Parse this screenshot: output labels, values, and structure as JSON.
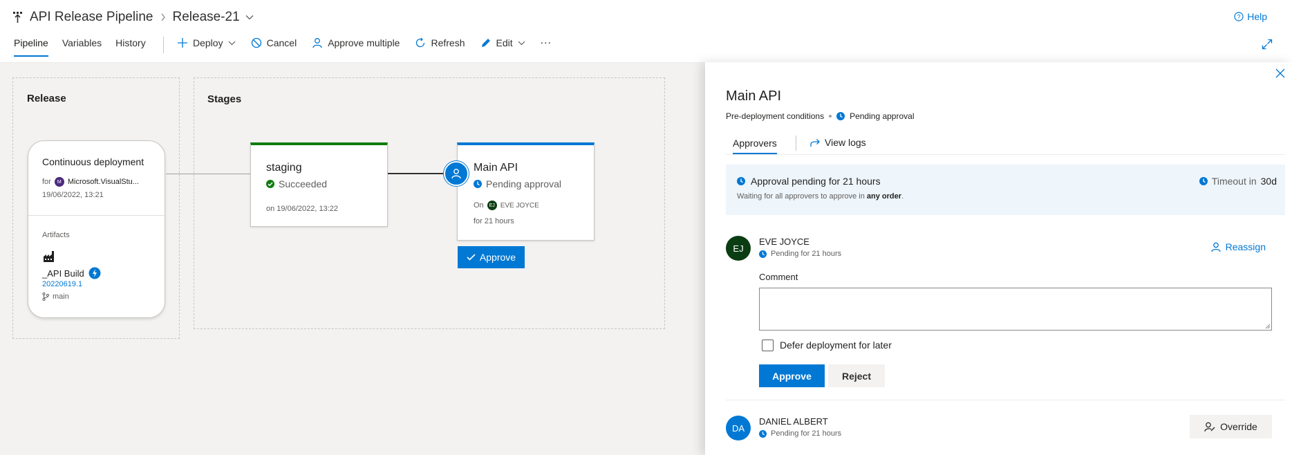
{
  "header": {
    "app_icon": "pipeline-icon",
    "pipeline_name": "API Release Pipeline",
    "release_name": "Release-21",
    "help_label": "Help"
  },
  "tabs": [
    {
      "label": "Pipeline",
      "active": true
    },
    {
      "label": "Variables",
      "active": false
    },
    {
      "label": "History",
      "active": false
    }
  ],
  "toolbar": {
    "deploy": "Deploy",
    "cancel": "Cancel",
    "approve_multiple": "Approve multiple",
    "refresh": "Refresh",
    "edit": "Edit",
    "more": "..."
  },
  "release_group": {
    "title": "Release",
    "trigger_title": "Continuous deployment",
    "for_label": "for",
    "source_badge": "M",
    "source": "Microsoft.VisualStu...",
    "timestamp": "19/06/2022, 13:21",
    "artifacts_label": "Artifacts",
    "artifact_name": "_API Build",
    "artifact_version": "20220619.1",
    "artifact_branch": "main"
  },
  "stages_group": {
    "title": "Stages",
    "staging": {
      "name": "staging",
      "status": "Succeeded",
      "date": "on 19/06/2022, 13:22",
      "color": "#107c10"
    },
    "main_api": {
      "name": "Main API",
      "status": "Pending approval",
      "on_label": "On",
      "approver_initials": "EJ",
      "approver": "EVE JOYCE",
      "duration": "for 21 hours",
      "color": "#0078d4",
      "approve_button": "Approve"
    }
  },
  "panel": {
    "title": "Main API",
    "conditions": "Pre-deployment conditions",
    "status": "Pending approval",
    "tabs": {
      "approvers": "Approvers",
      "view_logs": "View logs"
    },
    "banner": {
      "title": "Approval pending for 21 hours",
      "subtitle_prefix": "Waiting for all approvers to approve in ",
      "subtitle_bold": "any order",
      "subtitle_suffix": ".",
      "timeout_label": "Timeout in",
      "timeout_value": "30d"
    },
    "approvers": [
      {
        "initials": "EJ",
        "name": "EVE JOYCE",
        "status": "Pending for 21 hours",
        "avatar_color": "#0b3d13",
        "action": "Reassign",
        "comment_label": "Comment",
        "comment_value": "",
        "defer_label": "Defer deployment for later",
        "defer_checked": false,
        "approve_label": "Approve",
        "reject_label": "Reject"
      },
      {
        "initials": "DA",
        "name": "DANIEL ALBERT",
        "status": "Pending for 21 hours",
        "avatar_color": "#0078d4",
        "action": "Override"
      }
    ]
  },
  "colors": {
    "accent": "#0078d4",
    "success": "#107c10",
    "canvas": "#f3f2f1"
  }
}
